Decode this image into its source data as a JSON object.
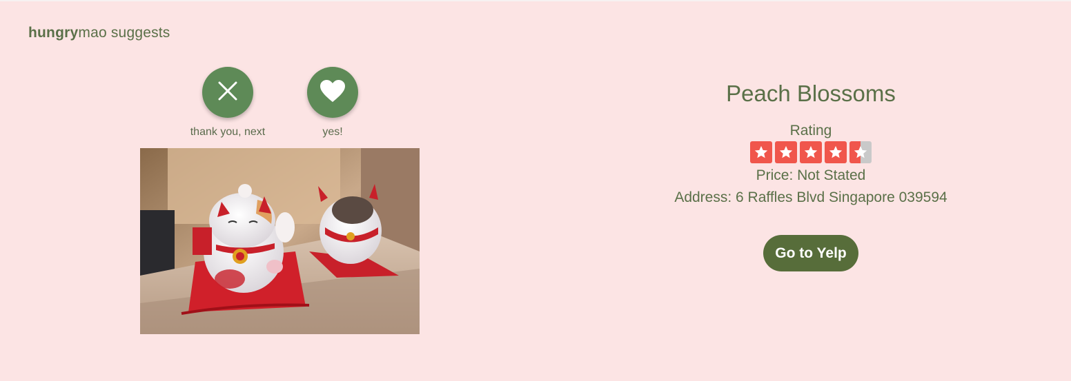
{
  "header": {
    "brand_bold": "hungry",
    "brand_light": "mao suggests"
  },
  "actions": {
    "next": {
      "label": "thank you, next",
      "icon": "close-icon"
    },
    "yes": {
      "label": "yes!",
      "icon": "heart-icon"
    }
  },
  "restaurant": {
    "name": "Peach Blossoms",
    "rating_label": "Rating",
    "rating_value": 4.5,
    "rating_max": 5,
    "price": "Price: Not Stated",
    "address": "Address: 6 Raffles Blvd Singapore 039594",
    "yelp_button": "Go to Yelp"
  },
  "colors": {
    "background": "#fce4e4",
    "accent_green": "#5e8a57",
    "button_dark_green": "#576d3a",
    "star_red": "#f0564c",
    "star_empty": "#c9c9c9"
  }
}
